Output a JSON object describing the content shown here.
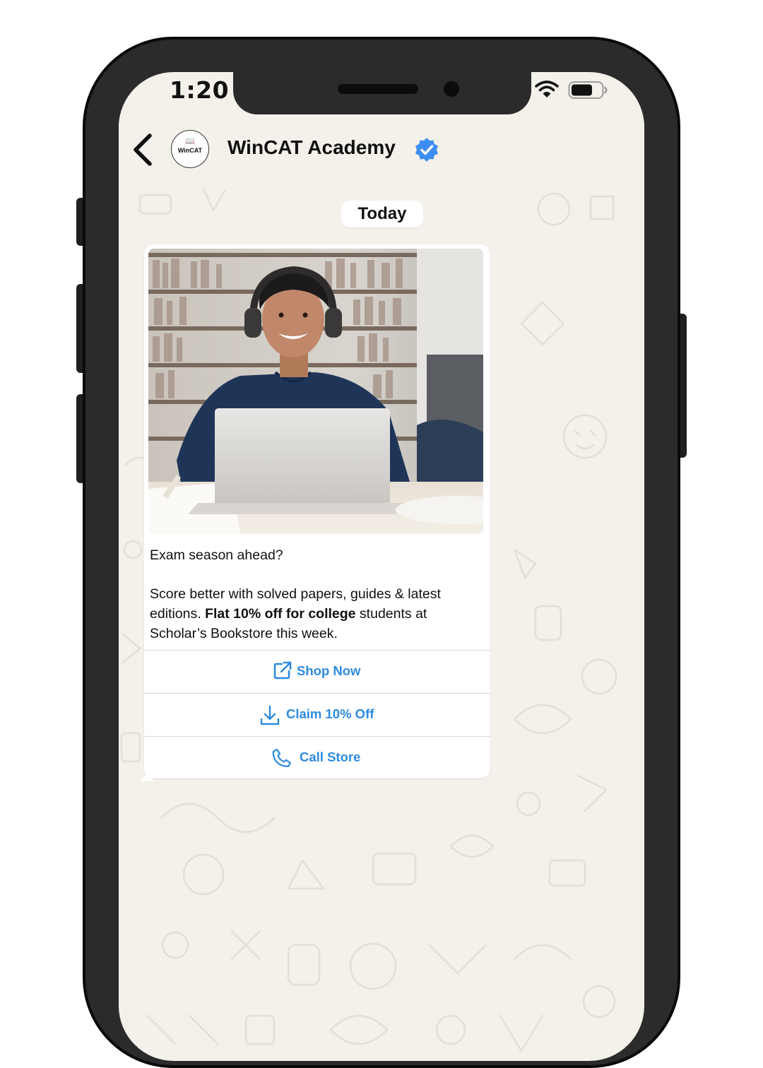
{
  "status_bar": {
    "time": "1:20",
    "icons": [
      "wifi-icon",
      "battery-icon"
    ]
  },
  "header": {
    "contact_name": "WinCAT Academy",
    "avatar_text": "WinCAT",
    "icons": [
      "back-chevron-icon",
      "verified-badge-icon"
    ]
  },
  "chat": {
    "date_label": "Today",
    "message": {
      "image_description_icon": "student-laptop-photo",
      "line_1": "Exam season ahead?",
      "para_2_start": "Score better with solved papers, guides & latest editions. ",
      "para_2_bold": "Flat 10% off for college",
      "para_2_end": " students at Scholar’s Bookstore this week.",
      "actions": [
        {
          "label": "Shop Now",
          "icon": "external-link-icon"
        },
        {
          "label": "Claim 10% Off",
          "icon": "download-icon"
        },
        {
          "label": "Call Store",
          "icon": "phone-icon"
        }
      ]
    }
  },
  "colors": {
    "chat_background": "#f4f1ea",
    "action_link": "#2e8be0",
    "verified_badge": "#3d8ef0",
    "phone_frame": "#2b2b2b"
  }
}
